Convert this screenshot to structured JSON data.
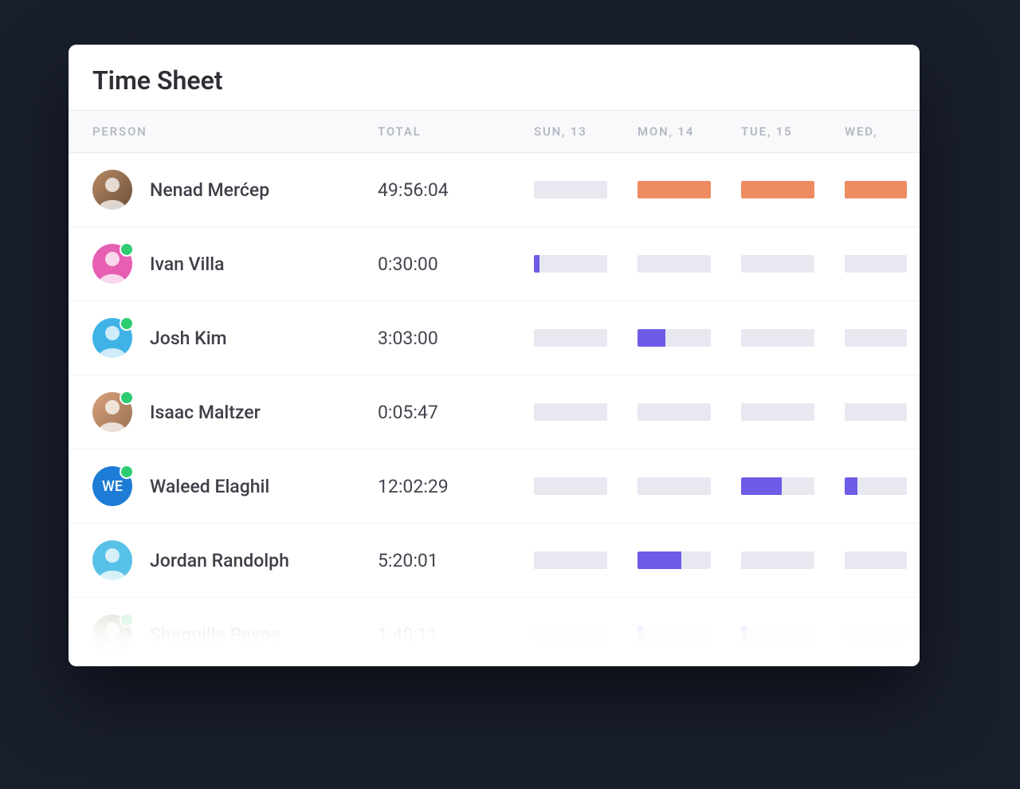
{
  "title": "Time Sheet",
  "columns": {
    "person": "PERSON",
    "total": "TOTAL",
    "days": [
      "SUN, 13",
      "MON, 14",
      "TUE, 15",
      "WED,"
    ]
  },
  "colors": {
    "bar_orange": "#ef8b61",
    "bar_purple": "#6c5ce7",
    "bar_empty": "#e7e8f0"
  },
  "rows": [
    {
      "name": "Nenad Merćep",
      "total": "49:56:04",
      "online": false,
      "avatar_type": "photo",
      "initials": "",
      "days": [
        {
          "fill": 0,
          "color": "none"
        },
        {
          "fill": 100,
          "color": "orange"
        },
        {
          "fill": 100,
          "color": "orange"
        },
        {
          "fill": 100,
          "color": "orange"
        }
      ]
    },
    {
      "name": "Ivan Villa",
      "total": "0:30:00",
      "online": true,
      "avatar_type": "photo",
      "initials": "",
      "days": [
        {
          "fill": 8,
          "color": "purple"
        },
        {
          "fill": 0,
          "color": "none"
        },
        {
          "fill": 0,
          "color": "none"
        },
        {
          "fill": 0,
          "color": "none"
        }
      ]
    },
    {
      "name": "Josh Kim",
      "total": "3:03:00",
      "online": true,
      "avatar_type": "photo",
      "initials": "",
      "days": [
        {
          "fill": 0,
          "color": "none"
        },
        {
          "fill": 38,
          "color": "purple"
        },
        {
          "fill": 0,
          "color": "none"
        },
        {
          "fill": 0,
          "color": "none"
        }
      ]
    },
    {
      "name": "Isaac Maltzer",
      "total": "0:05:47",
      "online": true,
      "avatar_type": "photo",
      "initials": "",
      "days": [
        {
          "fill": 0,
          "color": "none"
        },
        {
          "fill": 0,
          "color": "none"
        },
        {
          "fill": 0,
          "color": "none"
        },
        {
          "fill": 0,
          "color": "none"
        }
      ]
    },
    {
      "name": "Waleed Elaghil",
      "total": "12:02:29",
      "online": true,
      "avatar_type": "initials",
      "initials": "WE",
      "days": [
        {
          "fill": 0,
          "color": "none"
        },
        {
          "fill": 0,
          "color": "none"
        },
        {
          "fill": 55,
          "color": "purple"
        },
        {
          "fill": 20,
          "color": "purple"
        }
      ]
    },
    {
      "name": "Jordan Randolph",
      "total": "5:20:01",
      "online": false,
      "avatar_type": "photo",
      "initials": "",
      "days": [
        {
          "fill": 0,
          "color": "none"
        },
        {
          "fill": 60,
          "color": "purple"
        },
        {
          "fill": 0,
          "color": "none"
        },
        {
          "fill": 0,
          "color": "none"
        }
      ]
    },
    {
      "name": "Shaquille Payne",
      "total": "1:40:11",
      "online": true,
      "avatar_type": "photo",
      "initials": "",
      "days": [
        {
          "fill": 0,
          "color": "none"
        },
        {
          "fill": 8,
          "color": "purple"
        },
        {
          "fill": 8,
          "color": "purple"
        },
        {
          "fill": 0,
          "color": "none"
        }
      ]
    }
  ]
}
